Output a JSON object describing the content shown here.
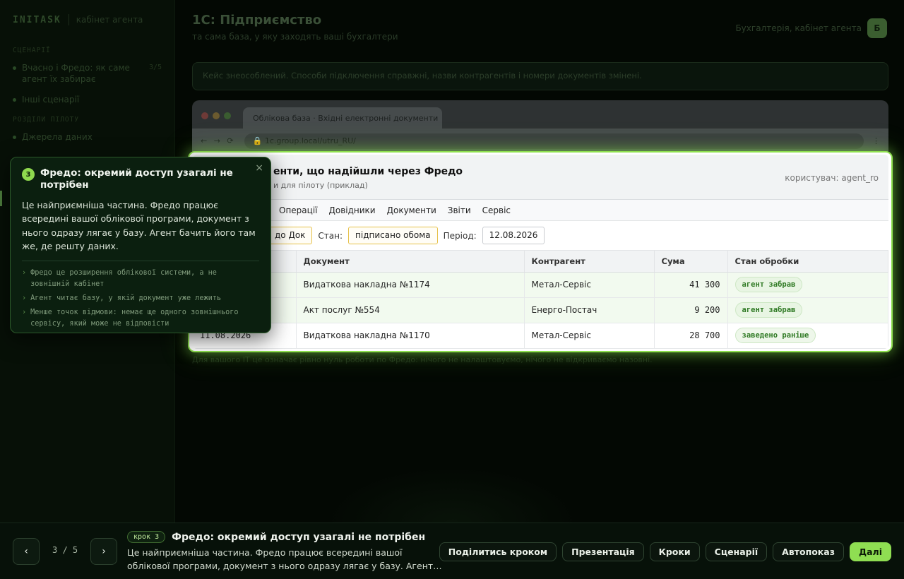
{
  "sidebar": {
    "logo": "INITASK",
    "subtitle": "кабінет агента",
    "section_scenario": "СЦЕНАРІЇ",
    "scenario_items": [
      {
        "label": "Вчасно і Фредо: як саме агент їх забирає",
        "count": "3/5"
      },
      {
        "label": "Інші сценарії"
      }
    ],
    "section_pilot": "РОЗДІЛИ ПІЛОТУ",
    "pilot_items": [
      {
        "label": "Джерела даних"
      }
    ]
  },
  "header": {
    "title": "1С: Підприємство",
    "subtitle": "та сама база, у яку заходять ваші бухгалтери",
    "user_label": "Бухгалтерія, кабінет агента",
    "avatar_letter": "Б"
  },
  "notice": "Кейс знеособлений. Способи підключення справжні, назви контрагентів і номери документів змінені.",
  "browser": {
    "tab_title": "Облікова база · Вхідні електронні документи",
    "url": "1c.group.local/utru_RU/",
    "nav": "← → ⟳",
    "menu": "⋮"
  },
  "below_note": "Для вашого IT це означає рівно нуль роботи по Фредо: нічого не налаштовуємо, нічого не відкриваємо назовні.",
  "onec": {
    "title": "Документи, що надійшли через Фредо",
    "title_visible": "енти, що надійшли через Фредо",
    "subtitle": "и для пілоту (приклад)",
    "user": "користувач: agent_ro",
    "menu": [
      "Операції",
      "Довідники",
      "Документи",
      "Звіти",
      "Сервіс"
    ],
    "filters": {
      "source_value": "до Док",
      "state_label": "Стан:",
      "state_value": "підписано обома",
      "period_label": "Період:",
      "period_value": "12.08.2026"
    },
    "columns": [
      "Документ",
      "Контрагент",
      "Сума",
      "Стан обробки"
    ],
    "rows": [
      {
        "date": "",
        "doc": "Видаткова накладна №1174",
        "party": "Метал-Сервіс",
        "sum": "41 300",
        "state": "агент забрав"
      },
      {
        "date": "",
        "doc": "Акт послуг №554",
        "party": "Енерго-Постач",
        "sum": "9 200",
        "state": "агент забрав"
      },
      {
        "date": "11.08.2026",
        "doc": "Видаткова накладна №1170",
        "party": "Метал-Сервіс",
        "sum": "28 700",
        "state": "заведено раніше"
      }
    ]
  },
  "callout": {
    "step": "3",
    "title": "Фредо: окремий доступ узагалі не потрібен",
    "close": "×",
    "body": "Це найприємніша частина. Фредо працює всередині вашої облікової програми, документ з нього одразу лягає у базу. Агент бачить його там же, де решту даних.",
    "bullet_mark": "›",
    "bullets": [
      "Фредо це розширення облікової системи, а не зовнішній кабінет",
      "Агент читає базу, у якій документ уже лежить",
      "Менше точок відмови: немає ще одного зовнішнього сервісу, який може не відповісти"
    ]
  },
  "bottombar": {
    "prev": "‹",
    "next": "›",
    "counter": "3 / 5",
    "step_tag": "крок 3",
    "step_title": "Фредо: окремий доступ узагалі не потрібен",
    "step_desc": "Це найприємніша частина. Фредо працює всередині вашої облікової програми, документ з нього одразу лягає у базу. Агент…",
    "actions": {
      "share": "Поділитись кроком",
      "presentation": "Презентація",
      "steps": "Кроки",
      "scenarios": "Сценарії",
      "autoplay": "Автопоказ",
      "next": "Далі"
    }
  },
  "colors": {
    "accent": "#8fde52",
    "badge_green": "#2f7a24",
    "filter_border": "#e6c14a"
  }
}
